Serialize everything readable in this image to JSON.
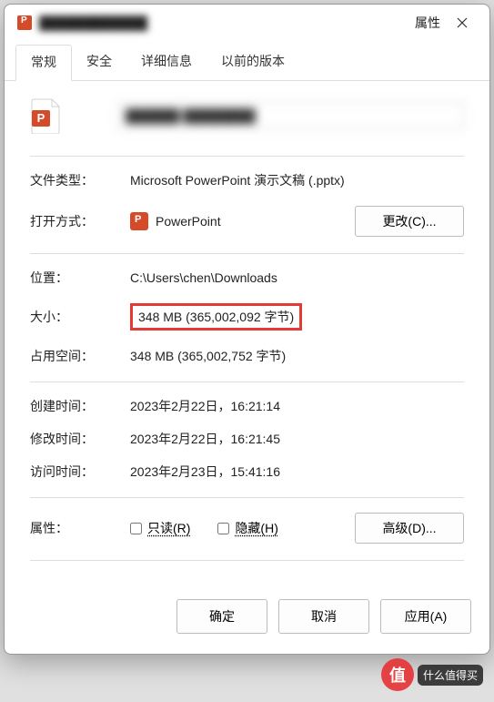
{
  "titlebar": {
    "obscured_title": "████████████",
    "suffix": "属性"
  },
  "tabs": {
    "general": "常规",
    "security": "安全",
    "details": "详细信息",
    "previous": "以前的版本"
  },
  "file": {
    "obscured_name": "██████ ████████"
  },
  "labels": {
    "type": "文件类型：",
    "openwith": "打开方式：",
    "location": "位置：",
    "size": "大小：",
    "sizeondisk": "占用空间：",
    "created": "创建时间：",
    "modified": "修改时间：",
    "accessed": "访问时间：",
    "attributes": "属性："
  },
  "values": {
    "type": "Microsoft PowerPoint 演示文稿 (.pptx)",
    "app": "PowerPoint",
    "location": "C:\\Users\\chen\\Downloads",
    "size": "348 MB (365,002,092 字节)",
    "sizeondisk": "348 MB (365,002,752 字节)",
    "created": "2023年2月22日，16:21:14",
    "modified": "2023年2月22日，16:21:45",
    "accessed": "2023年2月23日，15:41:16"
  },
  "buttons": {
    "change": "更改(C)...",
    "advanced": "高级(D)...",
    "ok": "确定",
    "cancel": "取消",
    "apply": "应用(A)"
  },
  "checkboxes": {
    "readonly": "只读(R)",
    "hidden": "隐藏(H)"
  },
  "watermark": {
    "symbol": "值",
    "text": "什么值得买"
  }
}
